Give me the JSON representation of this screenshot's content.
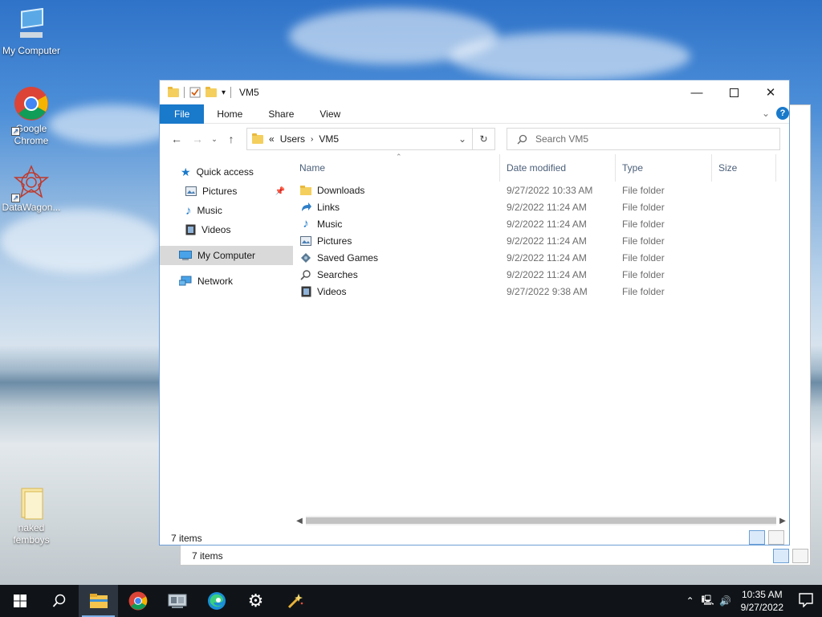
{
  "desktop": {
    "icons": [
      {
        "label": "My Computer"
      },
      {
        "label": "Google Chrome"
      },
      {
        "label": "DataWagon..."
      },
      {
        "label": "naked femboys"
      }
    ]
  },
  "ghost_window": {
    "status": "7 items"
  },
  "window": {
    "title": "VM5",
    "ribbon_tabs": [
      "File",
      "Home",
      "Share",
      "View"
    ],
    "address": {
      "chevrons": "«",
      "segments": [
        "Users",
        "VM5"
      ]
    },
    "search": {
      "placeholder": "Search VM5"
    },
    "nav": {
      "quick_access": "Quick access",
      "quick_items": [
        "Pictures",
        "Music",
        "Videos"
      ],
      "my_computer": "My Computer",
      "network": "Network"
    },
    "columns": [
      "Name",
      "Date modified",
      "Type",
      "Size"
    ],
    "rows": [
      {
        "name": "Downloads",
        "date": "9/27/2022 10:33 AM",
        "type": "File folder",
        "icon": "downloads-folder-icon"
      },
      {
        "name": "Links",
        "date": "9/2/2022 11:24 AM",
        "type": "File folder",
        "icon": "links-icon"
      },
      {
        "name": "Music",
        "date": "9/2/2022 11:24 AM",
        "type": "File folder",
        "icon": "music-icon"
      },
      {
        "name": "Pictures",
        "date": "9/2/2022 11:24 AM",
        "type": "File folder",
        "icon": "pictures-icon"
      },
      {
        "name": "Saved Games",
        "date": "9/2/2022 11:24 AM",
        "type": "File folder",
        "icon": "saved-games-icon"
      },
      {
        "name": "Searches",
        "date": "9/2/2022 11:24 AM",
        "type": "File folder",
        "icon": "searches-icon"
      },
      {
        "name": "Videos",
        "date": "9/27/2022 9:38 AM",
        "type": "File folder",
        "icon": "videos-icon"
      }
    ],
    "status": "7 items"
  },
  "taskbar": {
    "time": "10:35 AM",
    "date": "9/27/2022"
  },
  "colors": {
    "accent": "#1979ca",
    "taskbar": "#101418",
    "folder": "#f4cf5e"
  }
}
